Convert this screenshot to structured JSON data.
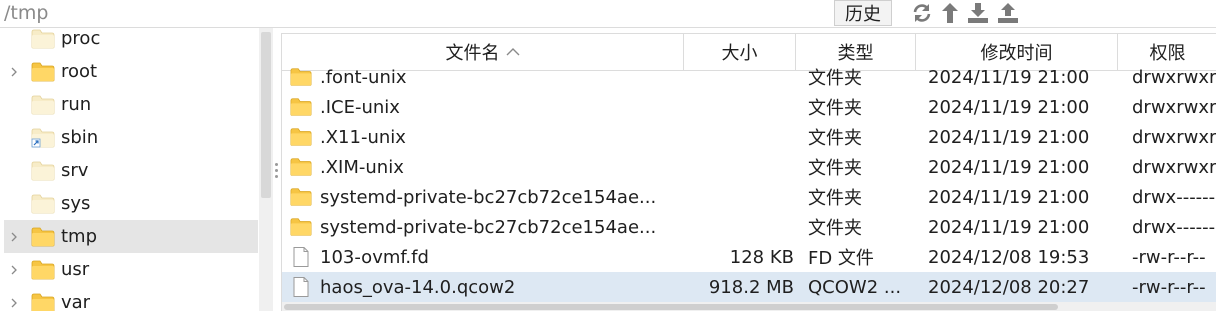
{
  "toolbar": {
    "path": "/tmp",
    "history_label": "历史",
    "icons": [
      "refresh-icon",
      "up-arrow-icon",
      "download-icon",
      "upload-icon"
    ]
  },
  "tree": {
    "items": [
      {
        "label": "proc",
        "expandable": false,
        "folder": "plain"
      },
      {
        "label": "root",
        "expandable": true,
        "folder": "yellow"
      },
      {
        "label": "run",
        "expandable": false,
        "folder": "plain"
      },
      {
        "label": "sbin",
        "expandable": false,
        "folder": "link"
      },
      {
        "label": "srv",
        "expandable": false,
        "folder": "plain"
      },
      {
        "label": "sys",
        "expandable": false,
        "folder": "plain"
      },
      {
        "label": "tmp",
        "expandable": true,
        "folder": "yellow",
        "selected": true
      },
      {
        "label": "usr",
        "expandable": true,
        "folder": "yellow"
      },
      {
        "label": "var",
        "expandable": true,
        "folder": "yellow"
      }
    ]
  },
  "filelist": {
    "columns": {
      "name": "文件名",
      "size": "大小",
      "type": "类型",
      "modified": "修改时间",
      "permissions": "权限"
    },
    "rows": [
      {
        "icon": "folder",
        "name": ".font-unix",
        "size": "",
        "type": "文件夹",
        "modified": "2024/11/19 21:00",
        "perm": "drwxrwxrwt"
      },
      {
        "icon": "folder",
        "name": ".ICE-unix",
        "size": "",
        "type": "文件夹",
        "modified": "2024/11/19 21:00",
        "perm": "drwxrwxrwt"
      },
      {
        "icon": "folder",
        "name": ".X11-unix",
        "size": "",
        "type": "文件夹",
        "modified": "2024/11/19 21:00",
        "perm": "drwxrwxrwt"
      },
      {
        "icon": "folder",
        "name": ".XIM-unix",
        "size": "",
        "type": "文件夹",
        "modified": "2024/11/19 21:00",
        "perm": "drwxrwxrwt"
      },
      {
        "icon": "folder",
        "name": "systemd-private-bc27cb72ce154ae...",
        "size": "",
        "type": "文件夹",
        "modified": "2024/11/19 21:00",
        "perm": "drwx------"
      },
      {
        "icon": "folder",
        "name": "systemd-private-bc27cb72ce154ae...",
        "size": "",
        "type": "文件夹",
        "modified": "2024/11/19 21:00",
        "perm": "drwx------"
      },
      {
        "icon": "file",
        "name": "103-ovmf.fd",
        "size": "128 KB",
        "type": "FD 文件",
        "modified": "2024/12/08 19:53",
        "perm": "-rw-r--r--"
      },
      {
        "icon": "file",
        "name": "haos_ova-14.0.qcow2",
        "size": "918.2 MB",
        "type": "QCOW2 ...",
        "modified": "2024/12/08 20:27",
        "perm": "-rw-r--r--",
        "selected": true
      }
    ]
  },
  "colors": {
    "folder_yellow": "#f6c544",
    "selected_row": "#dde8f3",
    "selected_tree": "#e5e5e5"
  }
}
